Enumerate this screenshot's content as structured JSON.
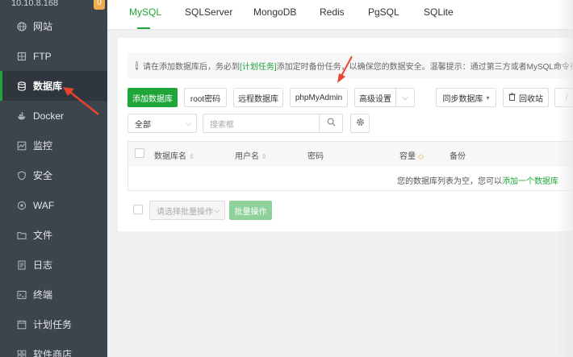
{
  "sidebar": {
    "ip": "10.10.8.168",
    "badge": "0",
    "items": [
      {
        "label": "网站",
        "icon": "globe-icon"
      },
      {
        "label": "FTP",
        "icon": "ftp-icon"
      },
      {
        "label": "数据库",
        "icon": "database-icon",
        "active": true
      },
      {
        "label": "Docker",
        "icon": "docker-icon"
      },
      {
        "label": "监控",
        "icon": "monitor-icon"
      },
      {
        "label": "安全",
        "icon": "shield-icon"
      },
      {
        "label": "WAF",
        "icon": "waf-icon"
      },
      {
        "label": "文件",
        "icon": "folder-icon"
      },
      {
        "label": "日志",
        "icon": "log-icon"
      },
      {
        "label": "终端",
        "icon": "terminal-icon"
      },
      {
        "label": "计划任务",
        "icon": "clock-icon"
      },
      {
        "label": "软件商店",
        "icon": "store-icon"
      }
    ]
  },
  "tabs": [
    "MySQL",
    "SQLServer",
    "MongoDB",
    "Redis",
    "PgSQL",
    "SQLite"
  ],
  "notice": {
    "pre": "请在添加数据库后，务必到",
    "link": "[计划任务]",
    "post": "添加定时备份任务，以确保您的数据安全。温馨提示：通过第三方或者MySQL命令行创建"
  },
  "toolbar": {
    "add_db": "添加数据库",
    "root_pwd": "root密码",
    "remote_db": "远程数据库",
    "phpmyadmin": "phpMyAdmin",
    "advanced": "高级设置",
    "sync": "同步数据库",
    "recycle": "回收站"
  },
  "filter": {
    "category": "全部",
    "search_placeholder": "搜索框"
  },
  "table": {
    "headers": [
      "数据库名",
      "用户名",
      "密码",
      "容量",
      "备份"
    ],
    "empty_text": "您的数据库列表为空，您可以",
    "empty_link": "添加一个数据库"
  },
  "batch": {
    "select_placeholder": "请选择批量操作",
    "button": "批量操作"
  },
  "colors": {
    "accent": "#20a53a",
    "sidebar_bg": "#3c444d",
    "annotation_arrow": "#e8432f"
  }
}
